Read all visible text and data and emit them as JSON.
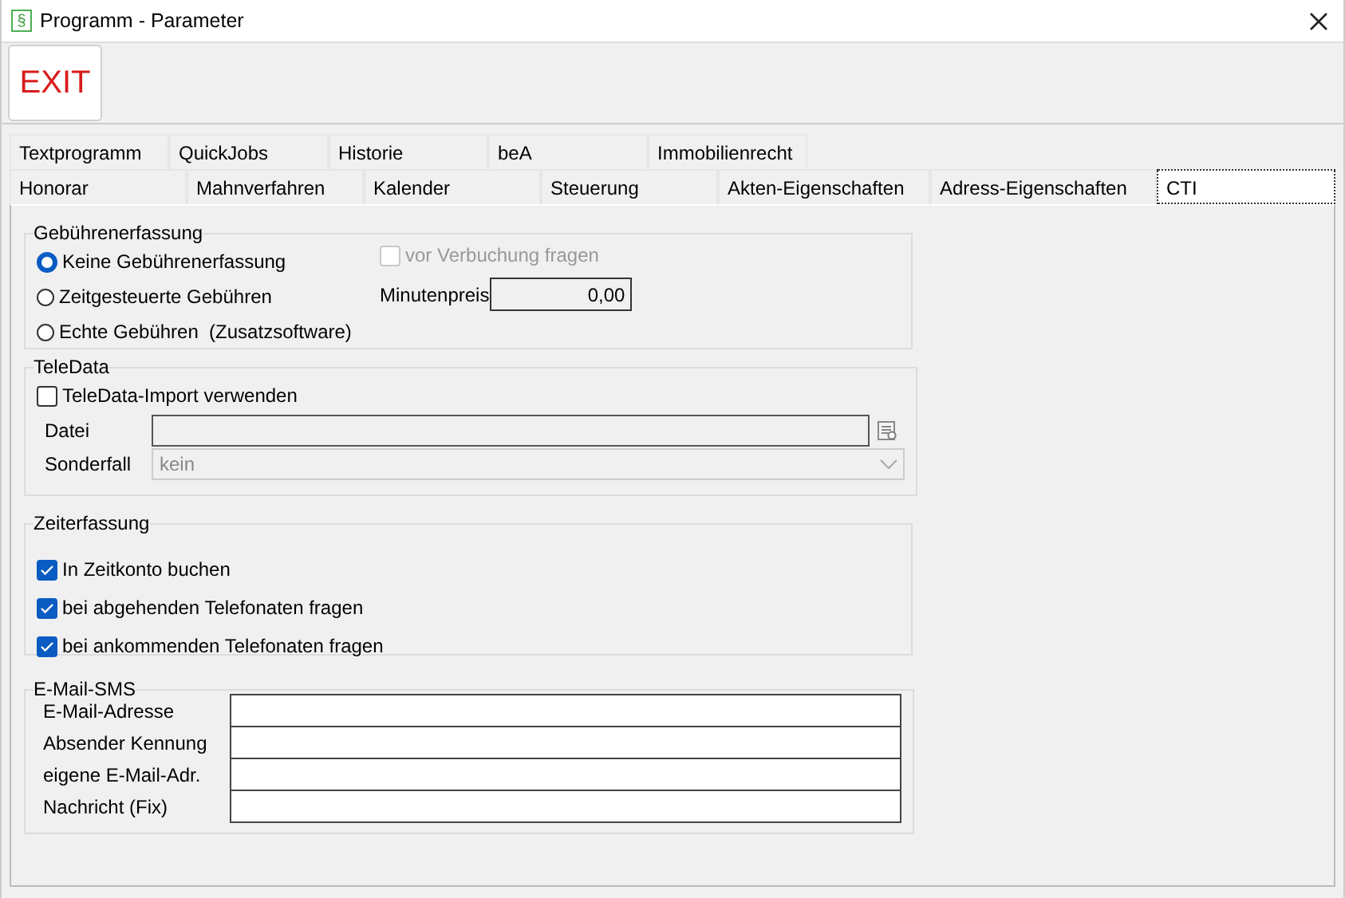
{
  "window": {
    "icon": "§",
    "title": "Programm - Parameter"
  },
  "toolbar": {
    "exit": "EXIT"
  },
  "tab_rows": [
    [
      {
        "label": "Textprogramm",
        "selected": false
      },
      {
        "label": "QuickJobs",
        "selected": false
      },
      {
        "label": "Historie",
        "selected": false
      },
      {
        "label": "beA",
        "selected": false
      },
      {
        "label": "Immobilienrecht",
        "selected": false
      }
    ],
    [
      {
        "label": "Honorar",
        "selected": false
      },
      {
        "label": "Mahnverfahren",
        "selected": false
      },
      {
        "label": "Kalender",
        "selected": false
      },
      {
        "label": "Steuerung",
        "selected": false
      },
      {
        "label": "Akten-Eigenschaften",
        "selected": false
      },
      {
        "label": "Adress-Eigenschaften",
        "selected": false
      },
      {
        "label": "CTI",
        "selected": true
      }
    ]
  ],
  "fee_capture": {
    "title": "Gebührenerfassung",
    "options": [
      {
        "label": "Keine Gebührenerfassung",
        "selected": true
      },
      {
        "label": "Zeitgesteuerte Gebühren",
        "selected": false
      },
      {
        "label": "Echte Gebühren  (Zusatzsoftware)",
        "selected": false
      }
    ],
    "ask_before_booking": {
      "label": "vor Verbuchung fragen",
      "checked": false,
      "disabled": true
    },
    "minute_price": {
      "label": "Minutenpreis",
      "value": "0,00"
    }
  },
  "teledata": {
    "title": "TeleData",
    "import": {
      "label": "TeleData-Import verwenden",
      "checked": false
    },
    "file": {
      "label": "Datei",
      "disabled": true
    },
    "special_case": {
      "label": "Sonderfall",
      "value": "kein",
      "disabled": true
    }
  },
  "time_capture": {
    "title": "Zeiterfassung",
    "options": [
      {
        "label": "In Zeitkonto buchen",
        "checked": true
      },
      {
        "label": "bei abgehenden Telefonaten fragen",
        "checked": true
      },
      {
        "label": "bei ankommenden Telefonaten fragen",
        "checked": true
      }
    ]
  },
  "email_sms": {
    "title": "E-Mail-SMS",
    "fields": [
      {
        "label": "E-Mail-Adresse"
      },
      {
        "label": "Absender Kennung"
      },
      {
        "label": "eigene E-Mail-Adr."
      },
      {
        "label": "Nachricht (Fix)"
      }
    ]
  }
}
